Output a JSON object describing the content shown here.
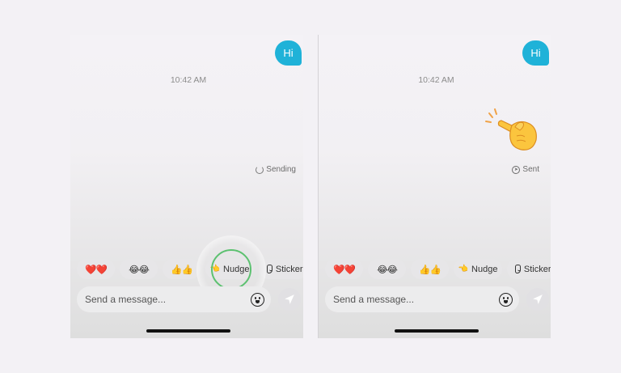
{
  "screens": [
    {
      "message": "Hi",
      "timestamp": "10:42 AM",
      "status": "Sending",
      "chips": {
        "hearts": "❤️❤️",
        "laughs": "😂😂",
        "thumbs": "👍👍",
        "nudge_icon": "👈",
        "nudge": "Nudge",
        "sticker": "Stickers"
      },
      "input_placeholder": "Send a message..."
    },
    {
      "message": "Hi",
      "timestamp": "10:42 AM",
      "status": "Sent",
      "chips": {
        "hearts": "❤️❤️",
        "laughs": "😂😂",
        "thumbs": "👍👍",
        "nudge_icon": "👈",
        "nudge": "Nudge",
        "sticker": "Stickers"
      },
      "input_placeholder": "Send a message..."
    }
  ],
  "icons": [
    "spinner-icon",
    "sent-check-icon",
    "sticker-icon",
    "emoji-face-icon",
    "send-arrow-icon",
    "pointing-hand-icon"
  ],
  "colors": {
    "bubble": "#1fb2d8",
    "highlight_ring": "#5cc170",
    "background": "#f3f1f5"
  }
}
